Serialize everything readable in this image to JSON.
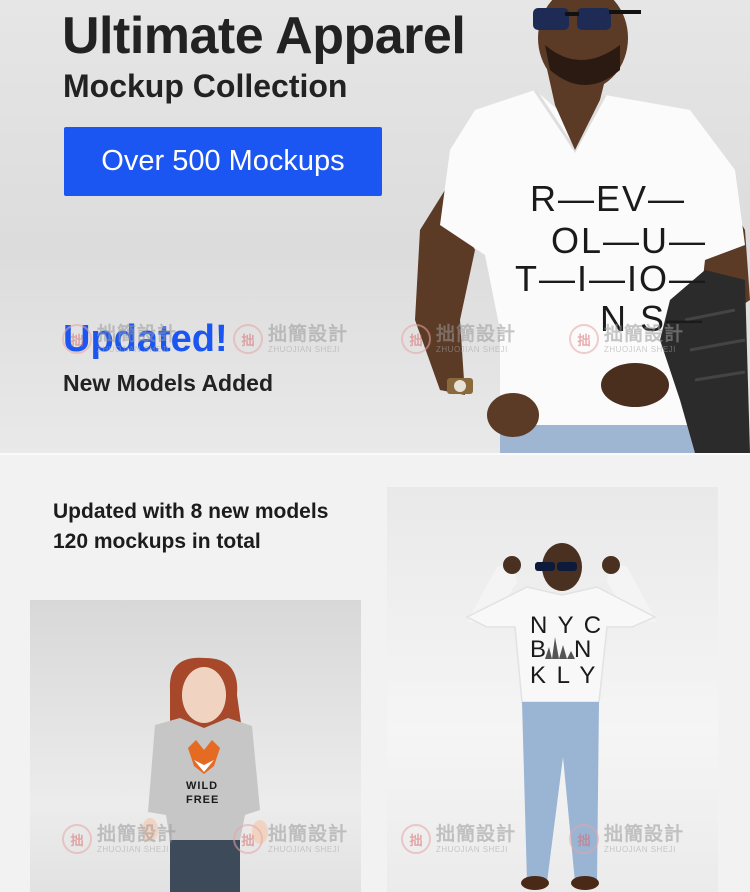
{
  "hero": {
    "title": "Ultimate Apparel",
    "subtitle": "Mockup Collection",
    "cta_label": "Over 500 Mockups",
    "updated_label": "Updated!",
    "new_models_label": "New Models Added",
    "tee_print": [
      "R—EV—",
      "OL—U—",
      "T—I—IO—",
      "N S—"
    ]
  },
  "stats": {
    "line1": "Updated with 8 new models",
    "line2": "120 mockups in total"
  },
  "woman_tee": {
    "print": [
      "WILD",
      "FREE"
    ]
  },
  "hoodie": {
    "print": [
      "N Y C",
      "B   N",
      "K L Y"
    ]
  },
  "watermark": {
    "cn": "拙簡設計",
    "en": "ZHUOJIAN SHEJI",
    "seal": "拙"
  },
  "colors": {
    "accent": "#1c56f2",
    "text": "#222222",
    "background": "#f2f2f2"
  }
}
